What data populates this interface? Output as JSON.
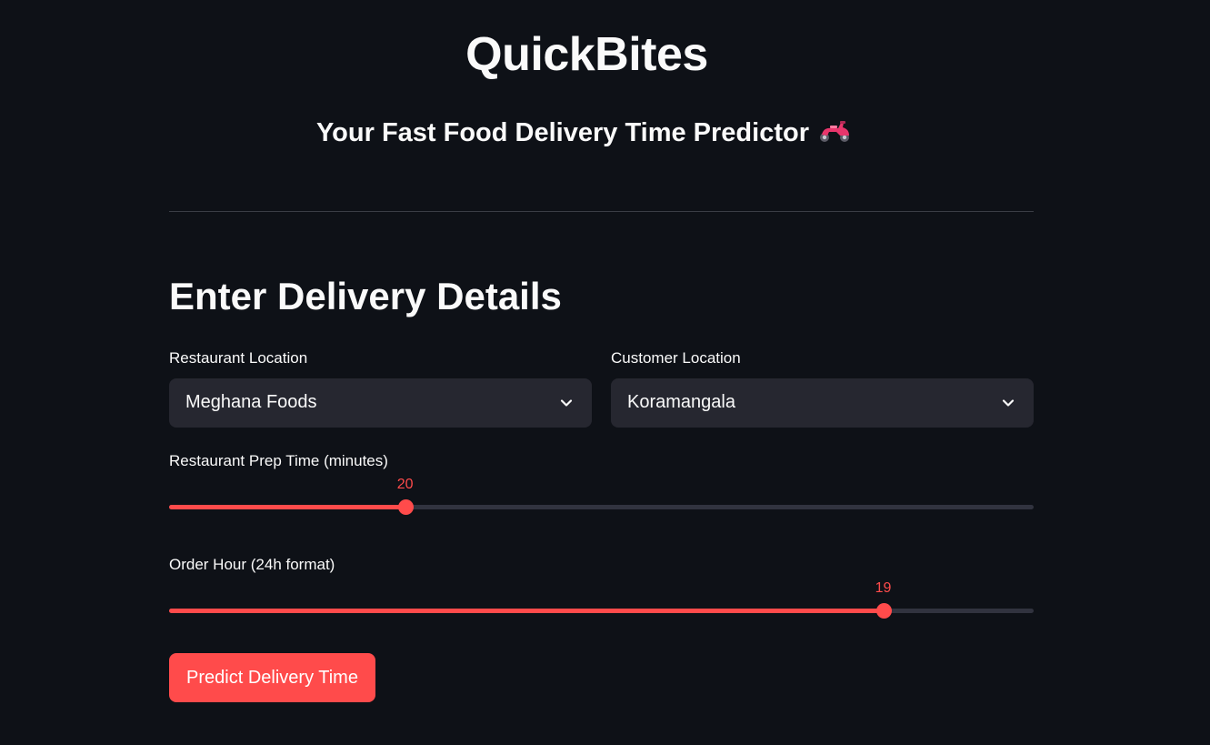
{
  "header": {
    "title": "QuickBites",
    "subtitle": "Your Fast Food Delivery Time Predictor",
    "subtitle_icon": "motor-scooter-icon"
  },
  "form": {
    "section_title": "Enter Delivery Details",
    "restaurant_location": {
      "label": "Restaurant Location",
      "value": "Meghana Foods"
    },
    "customer_location": {
      "label": "Customer Location",
      "value": "Koramangala"
    },
    "prep_time": {
      "label": "Restaurant Prep Time (minutes)",
      "value": "20",
      "fraction": 0.273
    },
    "order_hour": {
      "label": "Order Hour (24h format)",
      "value": "19",
      "fraction": 0.826
    },
    "predict_button_label": "Predict Delivery Time"
  },
  "colors": {
    "background": "#0e1117",
    "accent": "#ff4b4b",
    "input_bg": "#262730",
    "track": "#31333f"
  }
}
